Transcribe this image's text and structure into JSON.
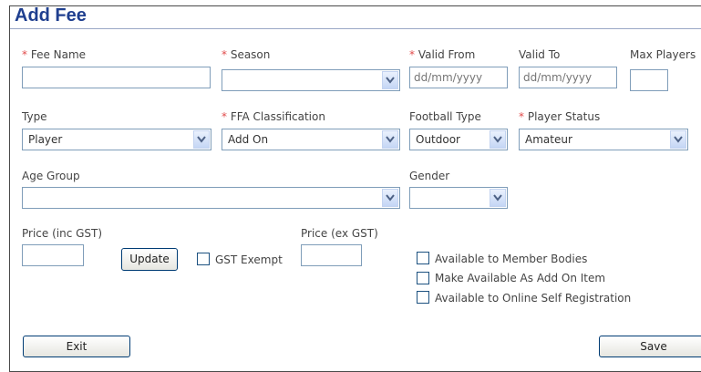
{
  "form": {
    "title": "Add Fee",
    "required_marker": "*"
  },
  "fields": {
    "fee_name": {
      "label": "Fee Name",
      "value": ""
    },
    "season": {
      "label": "Season",
      "value": ""
    },
    "valid_from": {
      "label": "Valid From",
      "placeholder": "dd/mm/yyyy"
    },
    "valid_to": {
      "label": "Valid To",
      "placeholder": "dd/mm/yyyy"
    },
    "max_players": {
      "label": "Max Players",
      "value": ""
    },
    "type": {
      "label": "Type",
      "value": "Player"
    },
    "ffa_classification": {
      "label": "FFA Classification",
      "value": "Add On"
    },
    "football_type": {
      "label": "Football Type",
      "value": "Outdoor"
    },
    "player_status": {
      "label": "Player Status",
      "value": "Amateur"
    },
    "age_group": {
      "label": "Age Group",
      "value": ""
    },
    "gender": {
      "label": "Gender",
      "value": ""
    },
    "price_inc_gst": {
      "label": "Price (inc GST)",
      "value": ""
    },
    "price_ex_gst": {
      "label": "Price (ex GST)",
      "value": ""
    }
  },
  "checkboxes": {
    "gst_exempt": {
      "label": "GST Exempt",
      "checked": false
    },
    "available_member_bodies": {
      "label": "Available to Member Bodies",
      "checked": false
    },
    "make_available_add_on": {
      "label": "Make Available As Add On Item",
      "checked": false
    },
    "available_online_self_registration": {
      "label": "Available to Online Self Registration",
      "checked": false
    }
  },
  "buttons": {
    "update": "Update",
    "exit": "Exit",
    "save": "Save"
  },
  "colors": {
    "title": "#1f3f8f",
    "required": "#e14b4b",
    "input_border": "#7f9db9",
    "button_border": "#003c74"
  }
}
